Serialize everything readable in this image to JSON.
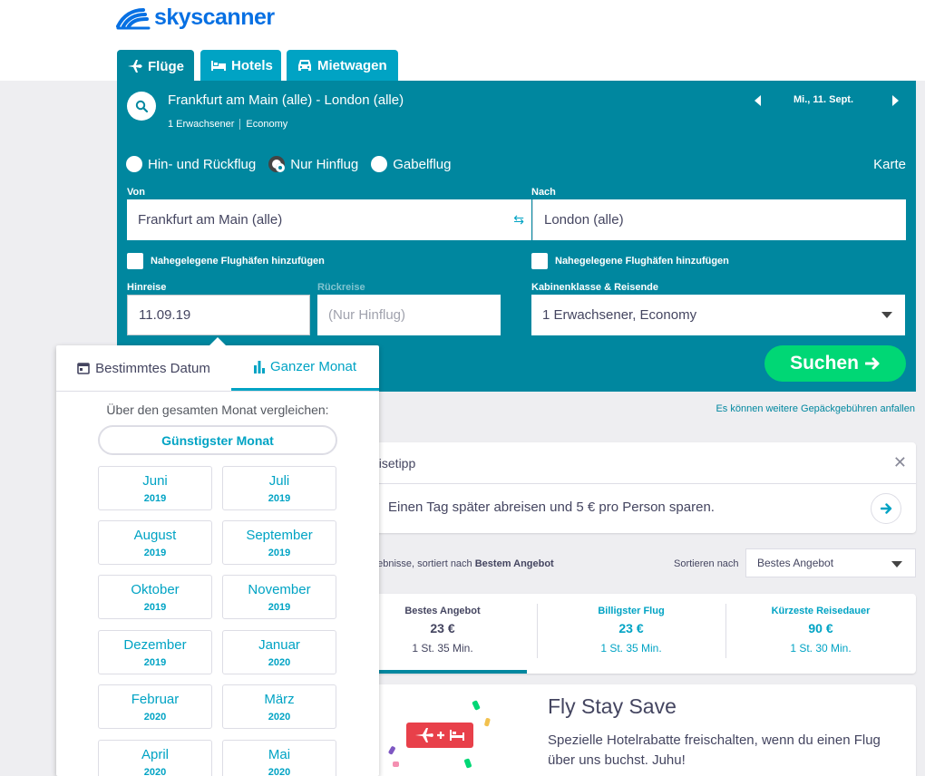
{
  "brand": {
    "name": "skyscanner"
  },
  "tabs": [
    {
      "label": "Flüge",
      "icon": "plane-icon"
    },
    {
      "label": "Hotels",
      "icon": "bed-icon"
    },
    {
      "label": "Mietwagen",
      "icon": "car-icon"
    }
  ],
  "search": {
    "route": "Frankfurt am Main (alle) - London (alle)",
    "passengers": "1 Erwachsener",
    "cabin": "Economy",
    "date": "Mi., 11. Sept."
  },
  "trip_types": [
    {
      "label": "Hin- und Rückflug",
      "selected": false
    },
    {
      "label": "Nur Hinflug",
      "selected": true
    },
    {
      "label": "Gabelflug",
      "selected": false
    }
  ],
  "map_link": "Karte",
  "from": {
    "label": "Von",
    "value": "Frankfurt am Main (alle)"
  },
  "to": {
    "label": "Nach",
    "value": "London (alle)"
  },
  "nearby_label": "Nahegelegene Flughäfen hinzufügen",
  "depart": {
    "label": "Hinreise",
    "value": "11.09.19"
  },
  "return": {
    "label": "Rückreise",
    "placeholder": "(Nur Hinflug)"
  },
  "cabin_travellers": {
    "label": "Kabinenklasse & Reisende",
    "value": "1 Erwachsener, Economy"
  },
  "search_button": "Suchen",
  "baggage_note": "Es können weitere Gepäckgebühren anfallen",
  "tip": {
    "title": "eisetipp",
    "text": "Einen Tag später abreisen und 5 € pro Person sparen."
  },
  "results": {
    "prefix": "gebnisse, sortiert nach ",
    "sort_bold": "Bestem Angebot",
    "sort_label": "Sortieren nach",
    "sort_value": "Bestes Angebot"
  },
  "summary": [
    {
      "title": "Bestes Angebot",
      "price": "23 €",
      "duration": "1 St. 35 Min."
    },
    {
      "title": "Billigster Flug",
      "price": "23 €",
      "duration": "1 St. 35 Min."
    },
    {
      "title": "Kürzeste Reisedauer",
      "price": "90 €",
      "duration": "1 St. 30 Min."
    }
  ],
  "promo": {
    "title": "Fly Stay Save",
    "text": "Spezielle Hotelrabatte freischalten, wenn du einen Flug über uns buchst. Juhu!"
  },
  "datepicker": {
    "tab_specific": "Bestimmtes Datum",
    "tab_month": "Ganzer Monat",
    "compare": "Über den gesamten Monat vergleichen:",
    "cheapest": "Günstigster Monat",
    "months": [
      {
        "m": "Juni",
        "y": "2019"
      },
      {
        "m": "Juli",
        "y": "2019"
      },
      {
        "m": "August",
        "y": "2019"
      },
      {
        "m": "September",
        "y": "2019"
      },
      {
        "m": "Oktober",
        "y": "2019"
      },
      {
        "m": "November",
        "y": "2019"
      },
      {
        "m": "Dezember",
        "y": "2019"
      },
      {
        "m": "Januar",
        "y": "2020"
      },
      {
        "m": "Februar",
        "y": "2020"
      },
      {
        "m": "März",
        "y": "2020"
      },
      {
        "m": "April",
        "y": "2020"
      },
      {
        "m": "Mai",
        "y": "2020"
      }
    ]
  },
  "colors": {
    "brand": "#0770e3",
    "panel": "#00879f",
    "tab": "#00a3c4",
    "cta": "#00d775"
  }
}
